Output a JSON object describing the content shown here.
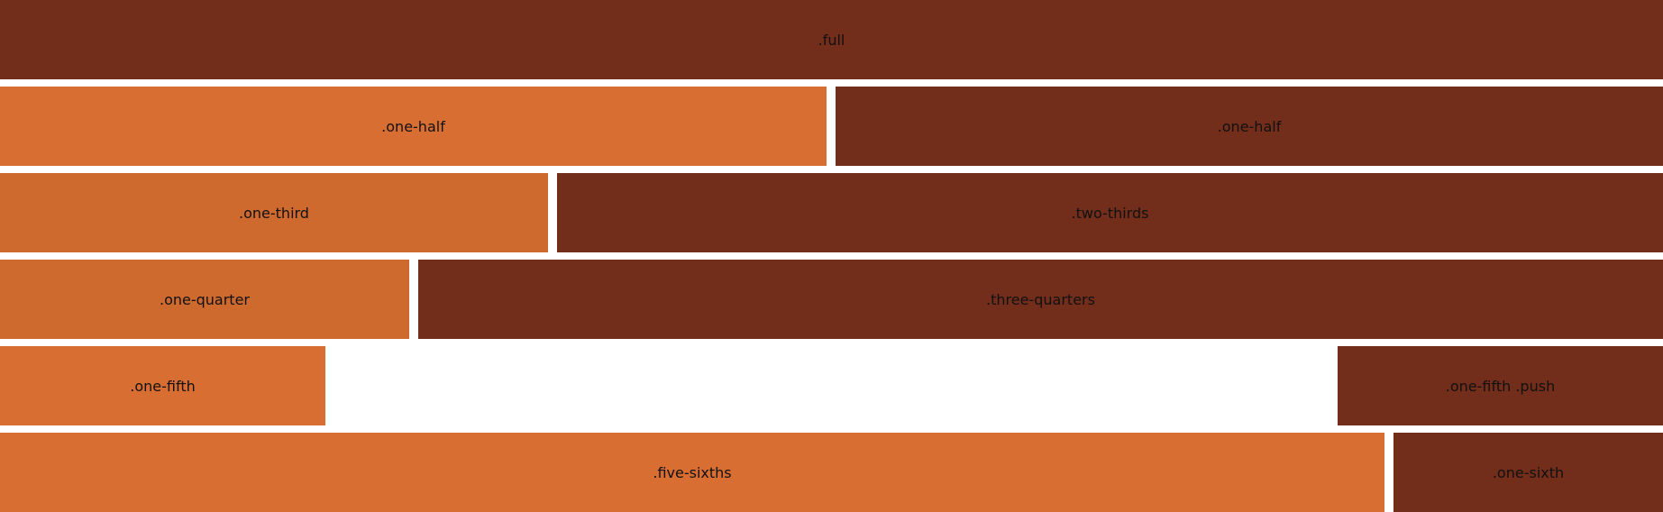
{
  "colors": {
    "dark": "#722d1b",
    "light": "#d96e33",
    "background": "#ffffff"
  },
  "rows": [
    {
      "cells": [
        {
          "label": ".full"
        }
      ]
    },
    {
      "cells": [
        {
          "label": ".one-half"
        },
        {
          "label": ".one-half"
        }
      ]
    },
    {
      "cells": [
        {
          "label": ".one-third"
        },
        {
          "label": ".two-thirds"
        }
      ]
    },
    {
      "cells": [
        {
          "label": ".one-quarter"
        },
        {
          "label": ".three-quarters"
        }
      ]
    },
    {
      "cells": [
        {
          "label": ".one-fifth"
        },
        {
          "label": ".one-fifth .push"
        }
      ]
    },
    {
      "cells": [
        {
          "label": ".five-sixths"
        },
        {
          "label": ".one-sixth"
        }
      ]
    }
  ]
}
